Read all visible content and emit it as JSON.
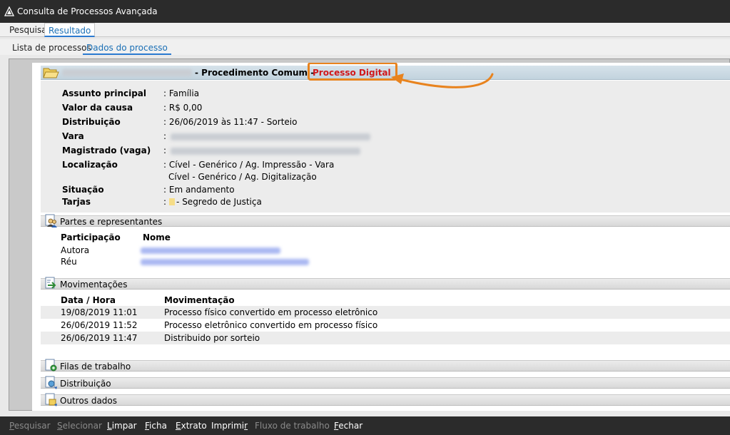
{
  "window": {
    "title": "Consulta de Processos Avançada"
  },
  "tabs": [
    {
      "label": "Pesquisa",
      "active": false
    },
    {
      "label": "Resultado",
      "active": true
    }
  ],
  "subtabs": [
    {
      "label": "Lista de processos",
      "active": false
    },
    {
      "label": "Dados do processo",
      "active": true
    }
  ],
  "process": {
    "class_label": "- Procedimento Comum -",
    "digital_label": "Processo Digital",
    "fields": [
      {
        "label": "Assunto principal",
        "value": ": Família"
      },
      {
        "label": "Valor da causa",
        "value": ": R$ 0,00"
      },
      {
        "label": "Distribuição",
        "value": ": 26/06/2019 às 11:47 - Sorteio"
      },
      {
        "label": "Vara",
        "value": ":"
      },
      {
        "label": "Magistrado (vaga)",
        "value": ":"
      },
      {
        "label": "Localização",
        "value": ": Cível - Genérico / Ag. Impressão - Vara",
        "value2": "Cível - Genérico / Ag. Digitalização"
      },
      {
        "label": "Situação",
        "value": ": Em andamento"
      },
      {
        "label": "Tarjas",
        "value": ":",
        "tag": "- Segredo de Justiça",
        "tag_color": "#f6dd88"
      }
    ]
  },
  "parties": {
    "section_title": "Partes e representantes",
    "col_participation": "Participação",
    "col_name": "Nome",
    "rows": [
      {
        "participation": "Autora"
      },
      {
        "participation": "Réu"
      }
    ]
  },
  "movements": {
    "section_title": "Movimentações",
    "col_date": "Data / Hora",
    "col_movement": "Movimentação",
    "rows": [
      {
        "date": "19/08/2019 11:01",
        "text": "Processo físico convertido em processo eletrônico"
      },
      {
        "date": "26/06/2019 11:52",
        "text": "Processo eletrônico convertido em processo físico"
      },
      {
        "date": "26/06/2019 11:47",
        "text": "Distribuido por sorteio"
      }
    ]
  },
  "sections": {
    "work_queues": "Filas de trabalho",
    "distribution": "Distribuição",
    "other_data": "Outros dados"
  },
  "toolbar": {
    "search": {
      "ul": "P",
      "rest": "esquisar"
    },
    "select": {
      "ul": "S",
      "rest": "elecionar"
    },
    "clear": {
      "ul": "L",
      "rest": "impar"
    },
    "record": {
      "ul": "F",
      "rest": "icha"
    },
    "extract": {
      "ul": "E",
      "rest": "xtrato"
    },
    "print_pre": "Imprimi",
    "print_ul": "r",
    "workflow": "Fluxo de trabalho",
    "close": {
      "ul": "F",
      "rest": "echar"
    }
  },
  "colors": {
    "digital": "#d0181c",
    "highlight": "#e8831e",
    "titlebar": "#2b2b2b",
    "link": "#1a6fb5"
  },
  "icons": [
    "app-icon",
    "folder-icon",
    "parties-icon",
    "movements-icon",
    "work-queues-icon",
    "distribution-icon",
    "other-data-icon"
  ]
}
